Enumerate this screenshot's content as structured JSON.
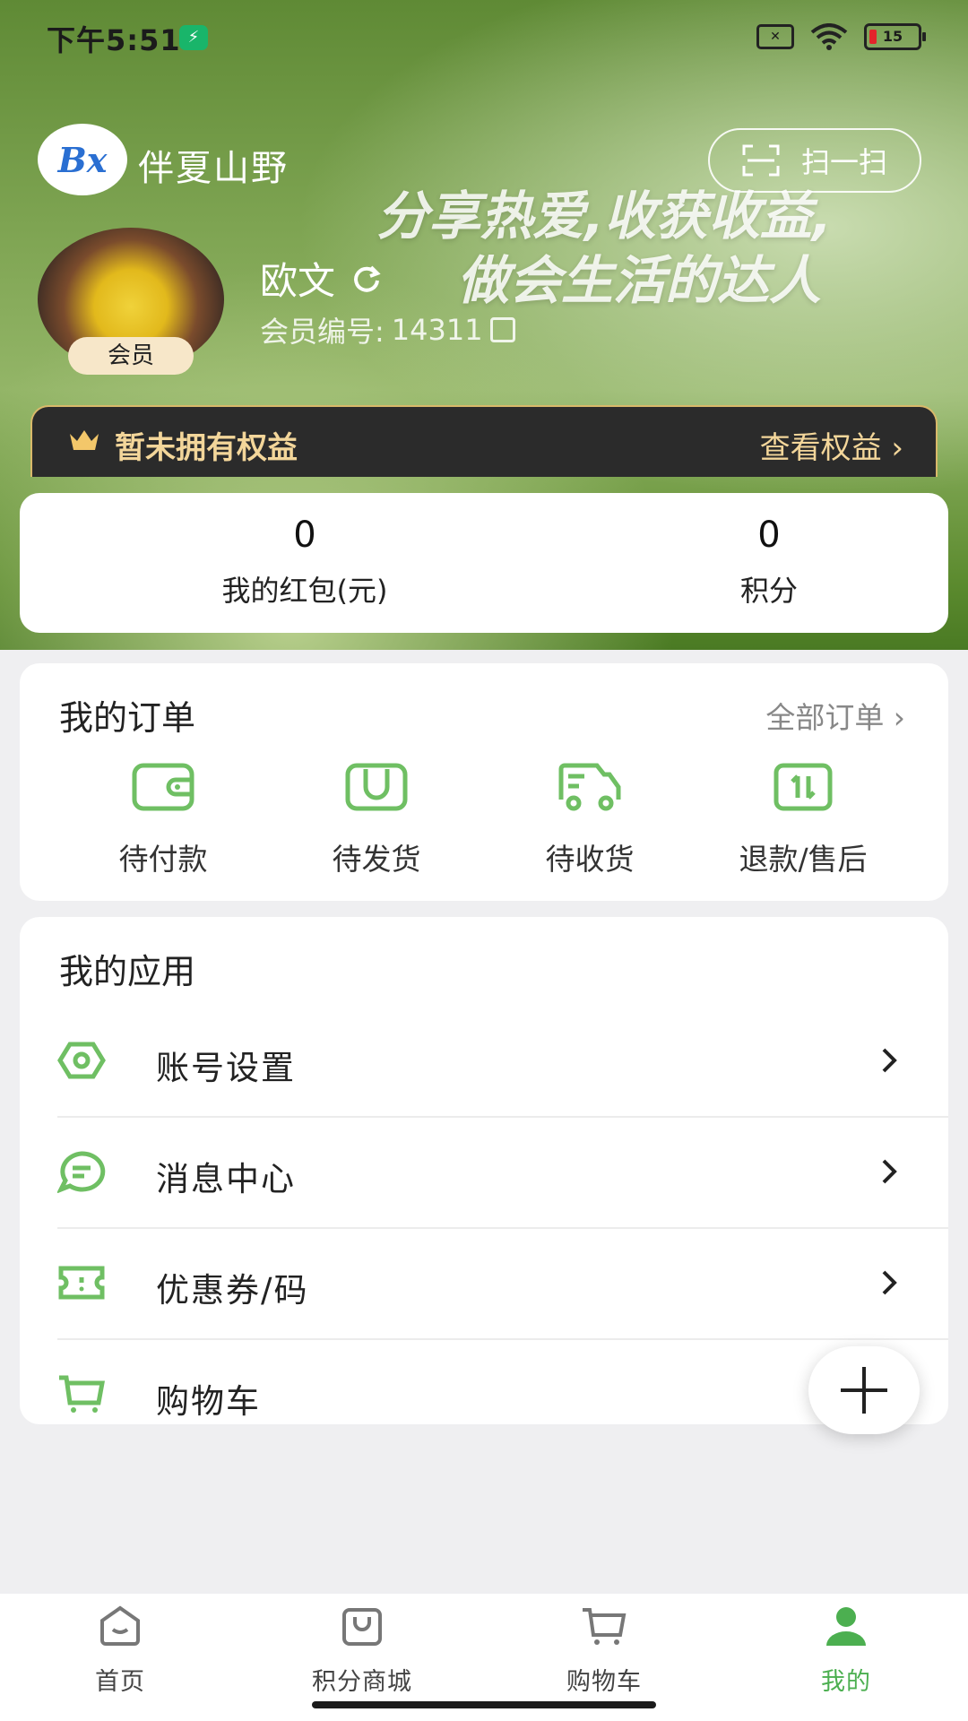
{
  "status_bar": {
    "time": "下午5:51",
    "battery": "15"
  },
  "header": {
    "brand_logo_text": "Bx",
    "brand_name": "伴夏山野",
    "scan_label": "扫一扫",
    "slogan_line1": "分享热爱,收获收益,",
    "slogan_line2": "做会生活的达人"
  },
  "profile": {
    "member_badge": "会员",
    "username": "欧文",
    "member_no_label": "会员编号:",
    "member_no": "14311"
  },
  "benefits": {
    "text": "暂未拥有权益",
    "link": "查看权益",
    "accent": "#f3d69a"
  },
  "wallet": [
    {
      "value": "0",
      "label": "我的红包(元)"
    },
    {
      "value": "0",
      "label": "积分"
    }
  ],
  "orders": {
    "title": "我的订单",
    "all_label": "全部订单",
    "items": [
      {
        "label": "待付款",
        "icon": "wallet-icon"
      },
      {
        "label": "待发货",
        "icon": "package-icon"
      },
      {
        "label": "待收货",
        "icon": "truck-icon"
      },
      {
        "label": "退款/售后",
        "icon": "refund-icon"
      }
    ]
  },
  "apps": {
    "title": "我的应用",
    "items": [
      {
        "label": "账号设置",
        "icon": "settings-icon"
      },
      {
        "label": "消息中心",
        "icon": "message-icon"
      },
      {
        "label": "优惠券/码",
        "icon": "coupon-icon"
      },
      {
        "label": "购物车",
        "icon": "cart-icon"
      }
    ]
  },
  "tabbar": {
    "items": [
      {
        "label": "首页",
        "icon": "home-icon"
      },
      {
        "label": "积分商城",
        "icon": "mall-icon"
      },
      {
        "label": "购物车",
        "icon": "cart-icon"
      },
      {
        "label": "我的",
        "icon": "user-icon",
        "active": true
      }
    ]
  },
  "colors": {
    "accent_green": "#4caf50",
    "icon_green": "#6fbf63",
    "benefit_bg": "#2b2b2b"
  }
}
